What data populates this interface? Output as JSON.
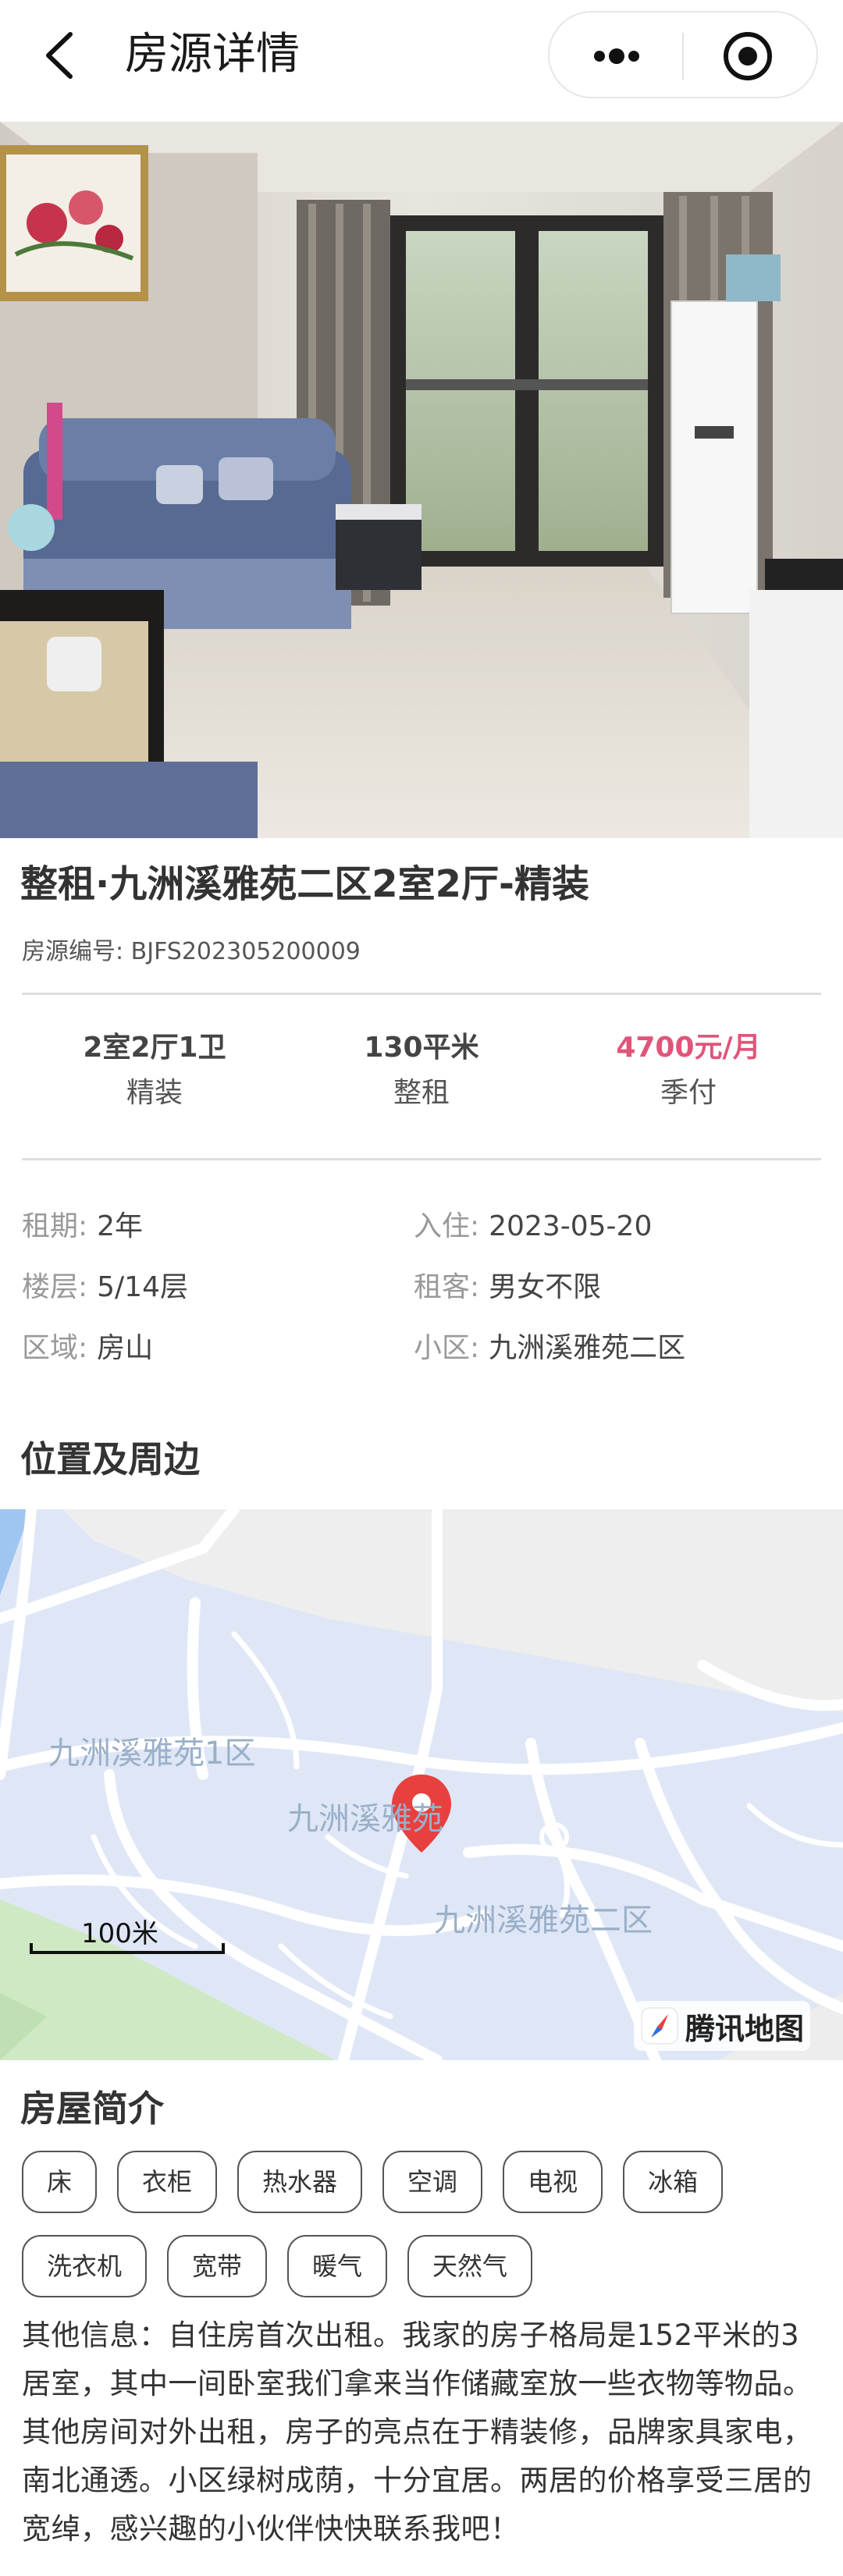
{
  "navbar": {
    "title": "房源详情",
    "back_icon": "chevron-left-icon",
    "more_icon": "more-dots-icon",
    "close_icon": "target-icon"
  },
  "carousel": {
    "image_desc": "living room photo",
    "slide_count": 9,
    "active_index": 0
  },
  "listing": {
    "title": "整租·九洲溪雅苑二区2室2厅-精装",
    "code_label": "房源编号: BJFS202305200009"
  },
  "stats": [
    {
      "top": "2室2厅1卫",
      "bottom": "精装"
    },
    {
      "top": "130平米",
      "bottom": "整租"
    },
    {
      "top": "4700元/月",
      "bottom": "季付"
    }
  ],
  "info": {
    "term_label": "租期:",
    "term_value": "2年",
    "movein_label": "入住:",
    "movein_value": "2023-05-20",
    "floor_label": "楼层:",
    "floor_value": "5/14层",
    "tenant_label": "租客:",
    "tenant_value": "男女不限",
    "area_label": "区域:",
    "area_value": "房山",
    "community_label": "小区:",
    "community_value": "九洲溪雅苑二区"
  },
  "location": {
    "title": "位置及周边",
    "map_labels": {
      "area1": "九洲溪雅苑1区",
      "area_main": "九洲溪雅苑",
      "area2": "九洲溪雅苑二区",
      "scale": "100米",
      "provider": "腾讯地图"
    }
  },
  "intro": {
    "title": "房屋简介",
    "tags": [
      "床",
      "衣柜",
      "热水器",
      "空调",
      "电视",
      "冰箱",
      "洗衣机",
      "宽带",
      "暖气",
      "天然气"
    ],
    "description": "其他信息：自住房首次出租。我家的房子格局是152平米的3居室，其中一间卧室我们拿来当作储藏室放一些衣物等物品。其他房间对外出租，房子的亮点在于精装修，品牌家具家电，南北通透。小区绿树成荫，十分宜居。两居的价格享受三居的宽绰，感兴趣的小伙伴快快联系我吧！"
  },
  "colors": {
    "price": "#e0557a",
    "map_bg": "#dfe7f7",
    "pin": "#e8403e"
  }
}
